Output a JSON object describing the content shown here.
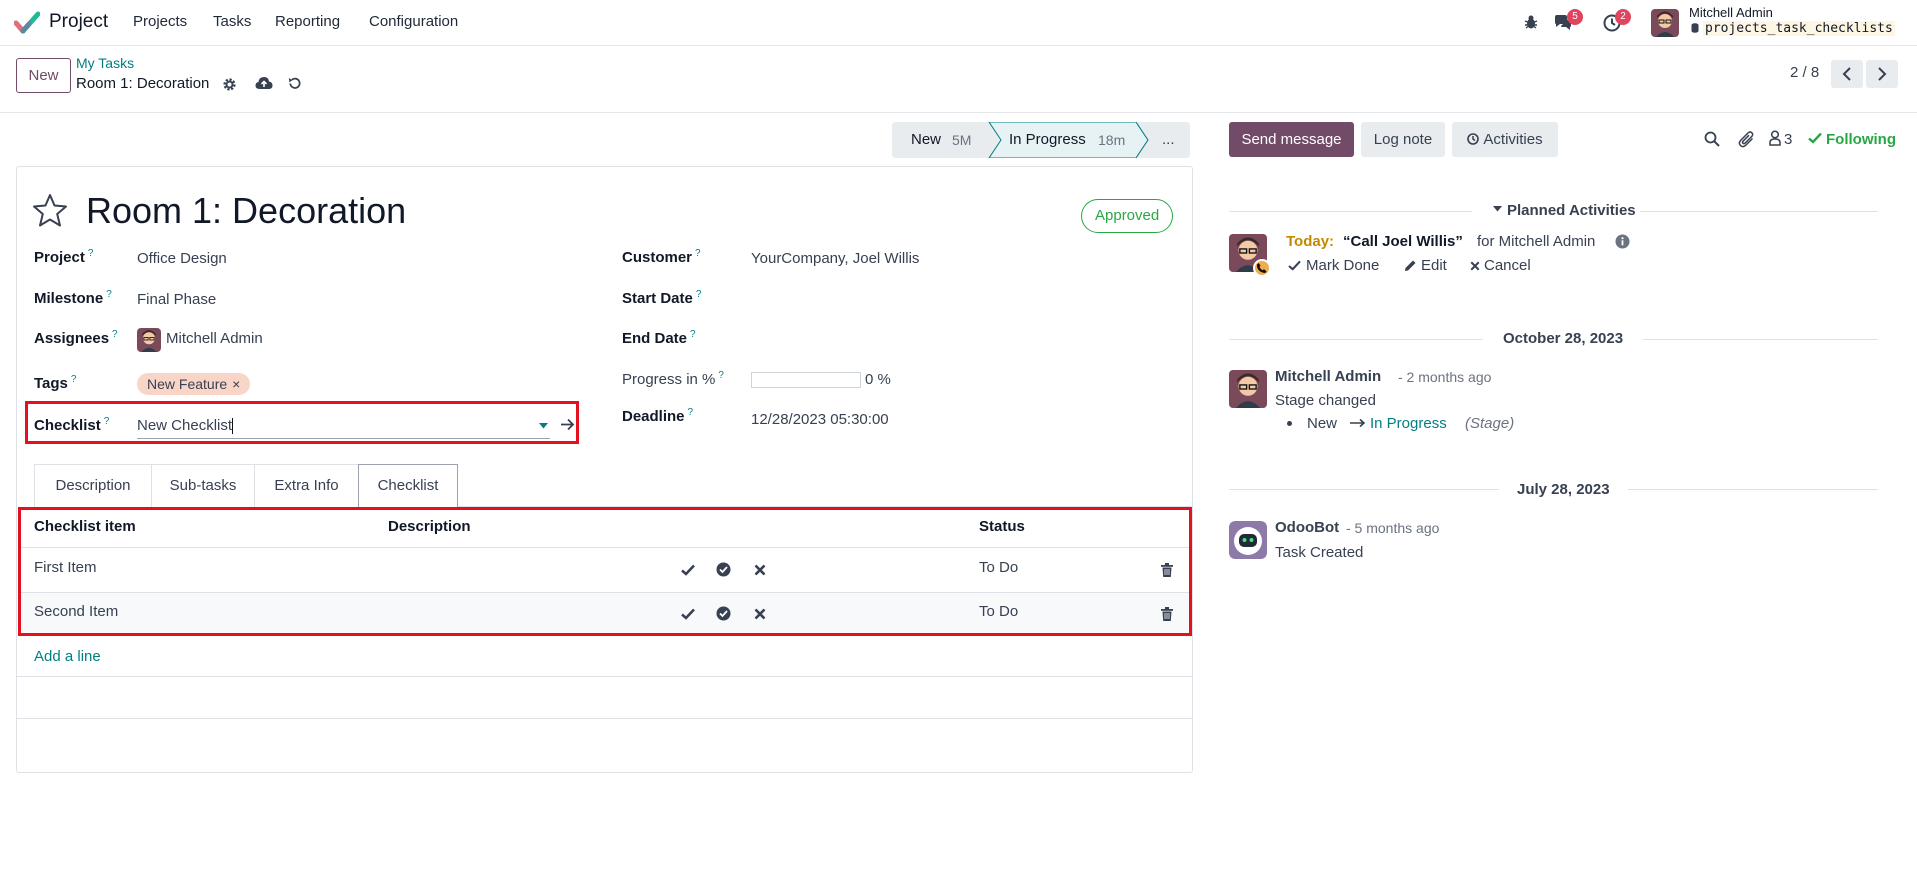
{
  "navbar": {
    "app_name": "Project",
    "menu": [
      "Projects",
      "Tasks",
      "Reporting",
      "Configuration"
    ],
    "messages_count": "5",
    "activities_count": "2",
    "user_name": "Mitchell Admin",
    "database": "projects_task_checklists"
  },
  "control_panel": {
    "new_label": "New",
    "breadcrumb_parent": "My Tasks",
    "record_title": "Room 1: Decoration",
    "pager": "2 / 8"
  },
  "statusbar": {
    "stages": [
      {
        "name": "New",
        "duration": "5M"
      },
      {
        "name": "In Progress",
        "duration": "18m"
      }
    ],
    "more_label": "..."
  },
  "form": {
    "title": "Room 1: Decoration",
    "status_badge": "Approved",
    "fields_left": {
      "project_label": "Project",
      "project_value": "Office Design",
      "milestone_label": "Milestone",
      "milestone_value": "Final Phase",
      "assignees_label": "Assignees",
      "assignees_value": "Mitchell Admin",
      "tags_label": "Tags",
      "tag_value": "New Feature",
      "checklist_label": "Checklist",
      "checklist_value": "New Checklist"
    },
    "fields_right": {
      "customer_label": "Customer",
      "customer_value": "YourCompany, Joel Willis",
      "start_date_label": "Start Date",
      "end_date_label": "End Date",
      "progress_label": "Progress in %",
      "progress_value": "0 %",
      "progress_fraction": 0,
      "deadline_label": "Deadline",
      "deadline_value": "12/28/2023 05:30:00"
    },
    "help_mark": "?",
    "tabs": [
      "Description",
      "Sub-tasks",
      "Extra Info",
      "Checklist"
    ],
    "checklist_table": {
      "columns": [
        "Checklist item",
        "Description",
        "Status"
      ],
      "rows": [
        {
          "item": "First Item",
          "description": "",
          "status": "To Do"
        },
        {
          "item": "Second Item",
          "description": "",
          "status": "To Do"
        }
      ],
      "add_line": "Add a line"
    }
  },
  "chatter": {
    "send_message": "Send message",
    "log_note": "Log note",
    "activities": "Activities",
    "followers_count": "3",
    "following": "Following",
    "planned_activities_title": "Planned Activities",
    "activity": {
      "when": "Today:",
      "summary": "“Call Joel Willis”",
      "for_text": "for Mitchell Admin",
      "mark_done": "Mark Done",
      "edit": "Edit",
      "cancel": "Cancel"
    },
    "messages": [
      {
        "date_separator": "October 28, 2023",
        "author": "Mitchell Admin",
        "time": "- 2 months ago",
        "body": "Stage changed",
        "change_old": "New",
        "change_new": "In Progress",
        "change_field": "(Stage)"
      },
      {
        "date_separator": "July 28, 2023",
        "author": "OdooBot",
        "time": "- 5 months ago",
        "body": "Task Created"
      }
    ]
  }
}
